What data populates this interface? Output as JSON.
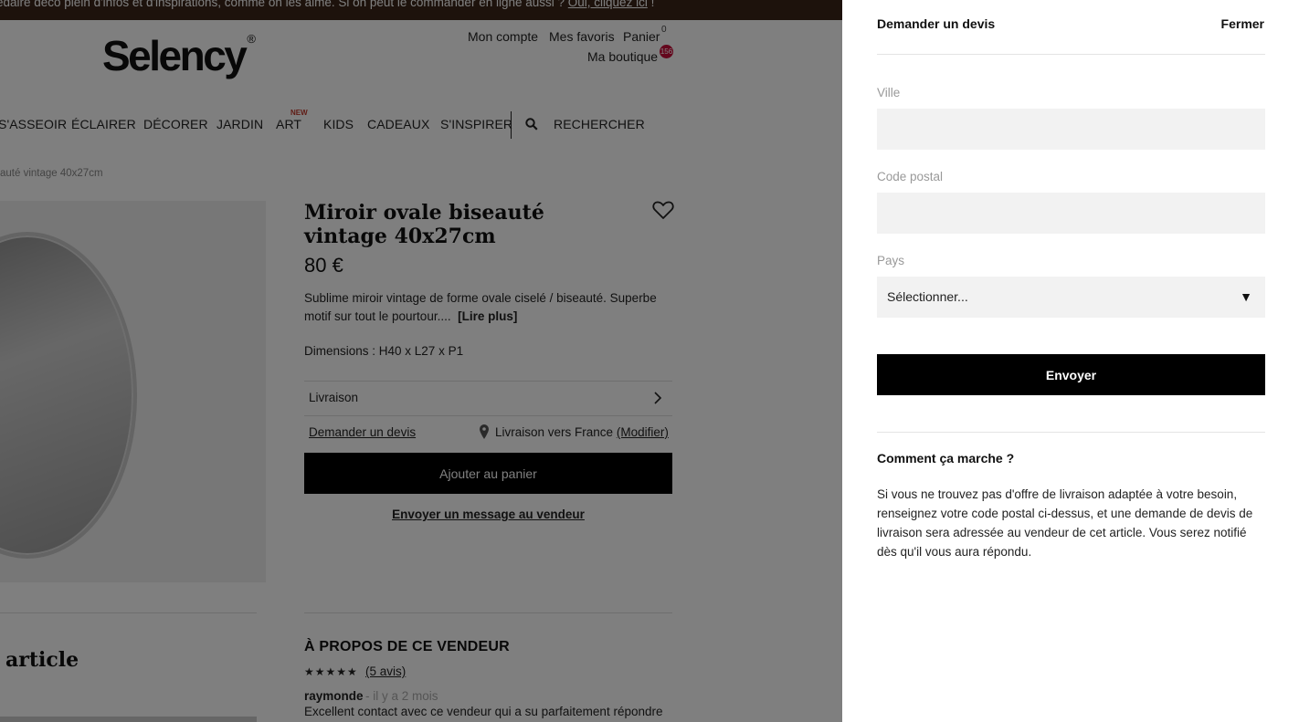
{
  "topbar": {
    "text": "edaire déco plein d'infos et d'inspirations, comme on les aime. Si on peut le commander en ligne aussi ?",
    "link": "Oui, cliquez ici",
    "suffix": " !"
  },
  "header": {
    "logo": "Selency",
    "logo_mark": "®",
    "my_account": "Mon compte",
    "favorites": "Mes favoris",
    "cart": "Panier",
    "cart_count": "0",
    "my_shop": "Ma boutique",
    "shop_badge": "156"
  },
  "nav": {
    "items": [
      "S'ASSEOIR",
      "ÉCLAIRER",
      "DÉCORER",
      "JARDIN",
      "ART",
      "KIDS",
      "CADEAUX",
      "S'INSPIRER"
    ],
    "new_tag": "NEW",
    "search": "RECHERCHER"
  },
  "breadcrumb": "auté vintage 40x27cm",
  "product": {
    "title": "Miroir ovale biseauté vintage 40x27cm",
    "price": "80 €",
    "description": "Sublime miroir vintage de forme ovale ciselé / biseauté. Superbe motif sur tout le pourtour....",
    "read_more": "[Lire plus]",
    "dimensions": "Dimensions : H40 x L27 x P1",
    "delivery": "Livraison",
    "request_quote": "Demander un devis",
    "ship_to": "Livraison vers France",
    "modify": "(Modifier)",
    "add_to_cart": "Ajouter au panier",
    "message_seller": "Envoyer un message au vendeur"
  },
  "lower": {
    "article_title": "article",
    "about_seller": "À PROPOS DE CE VENDEUR",
    "stars": "★★★★★",
    "reviews_link": "(5 avis)",
    "reviewer": "raymonde",
    "review_time": "- il y a 2 mois",
    "review_text": "Excellent contact avec ce vendeur qui a su parfaitement répondre"
  },
  "panel": {
    "title": "Demander un devis",
    "close": "Fermer",
    "city_label": "Ville",
    "city_value": "",
    "postal_label": "Code postal",
    "postal_value": "",
    "country_label": "Pays",
    "country_value": "Sélectionner...",
    "submit": "Envoyer",
    "how_title": "Comment ça marche ?",
    "how_text": "Si vous ne trouvez pas d'offre de livraison adaptée à votre besoin, renseignez votre code postal ci-dessus, et une demande de devis de livraison sera adressée au vendeur de cet article. Vous serez notifié dès qu'il vous aura répondu."
  },
  "colors": {
    "overlay": "rgba(0,0,0,0.5)",
    "primary_button": "#000000",
    "badge": "#c80f3a",
    "new_tag": "#c0392b"
  }
}
